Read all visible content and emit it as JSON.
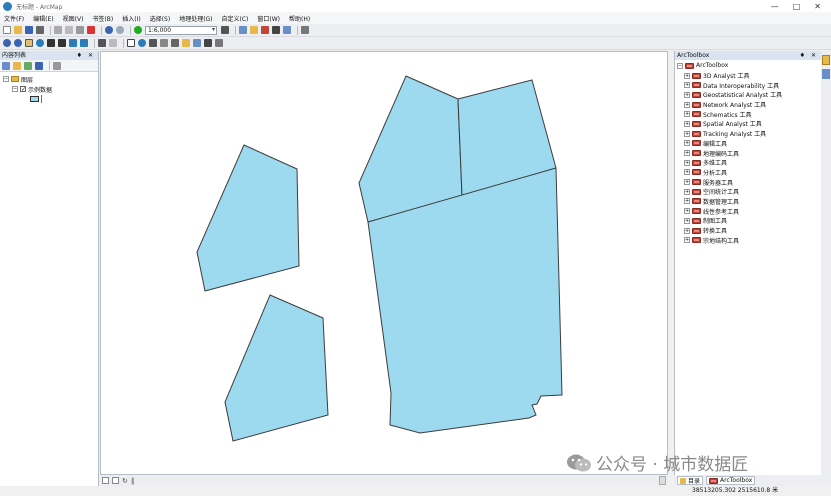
{
  "window": {
    "title": "无标题 - ArcMap",
    "controls": [
      "—",
      "□",
      "✕"
    ]
  },
  "menu": [
    "文件(F)",
    "编辑(E)",
    "视图(V)",
    "书签(B)",
    "插入(I)",
    "选择(S)",
    "地理处理(G)",
    "自定义(C)",
    "窗口(W)",
    "帮助(H)"
  ],
  "toolbar": {
    "scale_value": "1:6,000"
  },
  "toc": {
    "title": "内容列表",
    "controls": "♦ ✕",
    "tree": {
      "layers_label": "图层",
      "layer_label": "示例数据"
    }
  },
  "arctoolbox": {
    "title": "ArcToolbox",
    "controls": "♦ ✕",
    "root_label": "ArcToolbox",
    "items": [
      "3D Analyst 工具",
      "Data Interoperability 工具",
      "Geostatistical Analyst 工具",
      "Network Analyst 工具",
      "Schematics 工具",
      "Spatial Analyst 工具",
      "Tracking Analyst 工具",
      "编辑工具",
      "地理编码工具",
      "多维工具",
      "分析工具",
      "服务器工具",
      "空间统计工具",
      "数据管理工具",
      "线性参考工具",
      "制图工具",
      "转换工具",
      "宗地结构工具"
    ],
    "tabs": [
      "目录",
      "ArcToolbox"
    ]
  },
  "status": {
    "coordinates": "38513205.302  2515610.8 米"
  },
  "watermark": {
    "text": "公众号 · 城市数据匠"
  },
  "colors": {
    "polygon_fill": "#9dd9ef",
    "polygon_stroke": "#3c3c3c",
    "toolbox_red": "#c2433a"
  }
}
